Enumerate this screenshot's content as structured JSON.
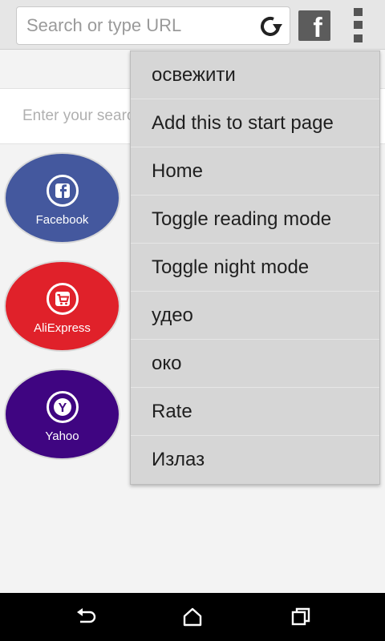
{
  "url_bar": {
    "placeholder": "Search or type URL"
  },
  "search": {
    "placeholder": "Enter your search"
  },
  "speed_dial": [
    {
      "label": "Facebook",
      "color": "#44589e",
      "icon": "facebook-icon"
    },
    {
      "label": "AliExpress",
      "color": "#e0212a",
      "icon": "cart-icon"
    },
    {
      "label": "Yahoo",
      "color": "#3f0581",
      "icon": "yahoo-icon"
    }
  ],
  "menu": {
    "items": [
      "освежити",
      "Add this to start page",
      "Home",
      "Toggle reading mode",
      "Toggle night mode",
      "удео",
      "око",
      "Rate",
      "Излаз"
    ]
  },
  "icons": {
    "facebook_top": "f",
    "yahoo_letter": "Y"
  },
  "colors": {
    "topbar": "#e6e6e6",
    "menu_background": "#d6d6d6",
    "navbar": "#000000"
  }
}
